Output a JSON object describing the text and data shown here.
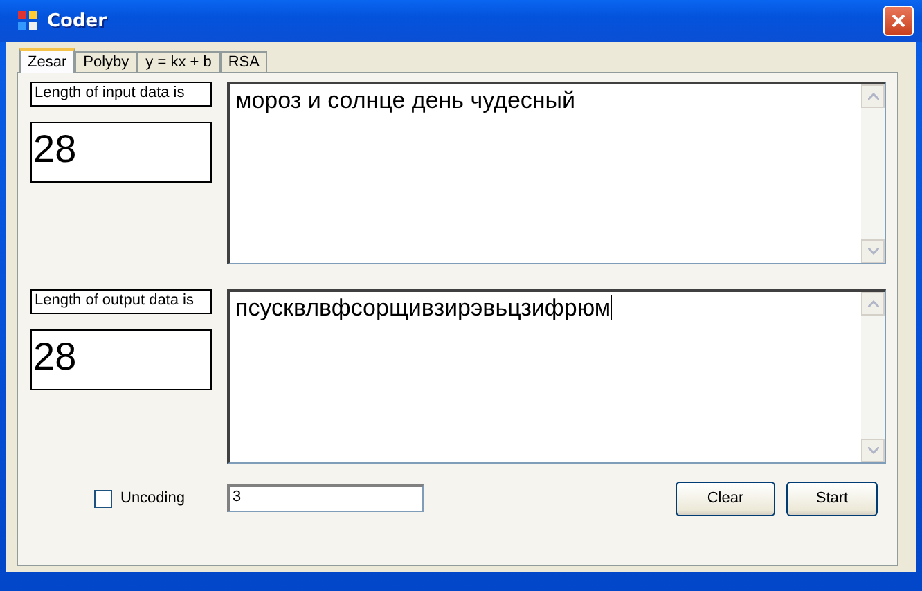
{
  "window": {
    "title": "Coder"
  },
  "tabs": [
    {
      "label": "Zesar",
      "selected": true
    },
    {
      "label": "Polyby",
      "selected": false
    },
    {
      "label": "y = kx + b",
      "selected": false
    },
    {
      "label": "RSA",
      "selected": false
    }
  ],
  "input": {
    "label": "Length of input data is",
    "length": "28",
    "text": "мороз и солнце день чудесный"
  },
  "output": {
    "label": "Length of output data is",
    "length": "28",
    "text": "псусквлвфсорщивзирэвьцзифрюм",
    "focused": true
  },
  "uncoding": {
    "label": "Uncoding",
    "checked": false
  },
  "key_field": {
    "value": "3"
  },
  "buttons": [
    {
      "label": "Clear"
    },
    {
      "label": "Start"
    }
  ]
}
